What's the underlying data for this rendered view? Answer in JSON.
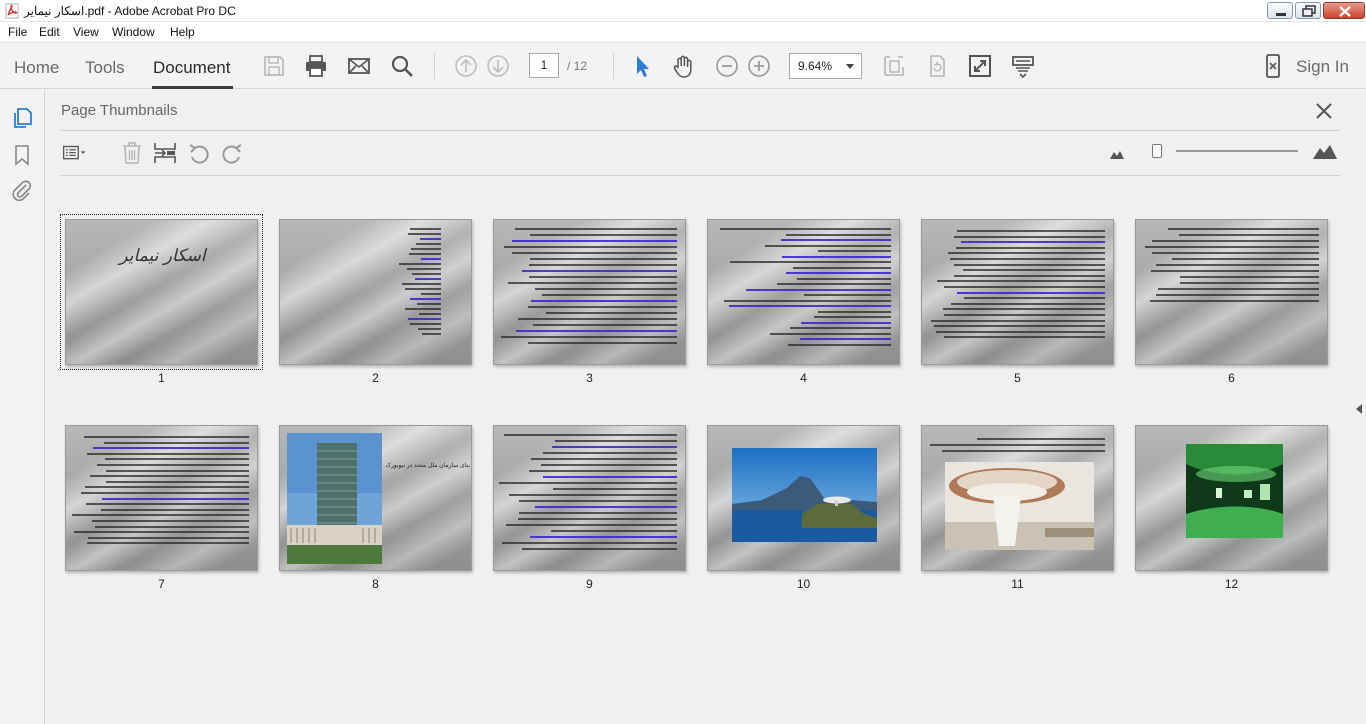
{
  "window": {
    "title": "اسکار نیمایر.pdf - Adobe Acrobat Pro DC"
  },
  "menu": [
    "File",
    "Edit",
    "View",
    "Window",
    "Help"
  ],
  "toolbar": {
    "tabs": [
      "Home",
      "Tools",
      "Document"
    ],
    "active_tab": "Document",
    "page_current": "1",
    "page_total": "/ 12",
    "zoom": "9.64%",
    "sign_in": "Sign In",
    "icons": [
      "save-icon",
      "print-icon",
      "email-icon",
      "search-icon",
      "prev-page-icon",
      "next-page-icon",
      "select-cursor-icon",
      "hand-icon",
      "zoom-out-icon",
      "zoom-in-icon",
      "fit-page-icon",
      "rotate-page-icon",
      "full-screen-icon",
      "scroll-mode-icon",
      "mobile-link-icon"
    ]
  },
  "rail": {
    "icons": [
      "page-thumbnails-icon",
      "bookmarks-icon",
      "attachments-icon"
    ]
  },
  "panel": {
    "title": "Page Thumbnails",
    "tools": [
      "options-menu-icon",
      "delete-page-icon",
      "insert-page-icon",
      "undo-icon",
      "redo-icon"
    ],
    "thumb_size_level": 0.2
  },
  "thumbnails": [
    {
      "label": "1",
      "kind": "title",
      "title": "اسکار نیمایر"
    },
    {
      "label": "2",
      "kind": "text"
    },
    {
      "label": "3",
      "kind": "text"
    },
    {
      "label": "4",
      "kind": "text"
    },
    {
      "label": "5",
      "kind": "text"
    },
    {
      "label": "6",
      "kind": "text"
    },
    {
      "label": "7",
      "kind": "text"
    },
    {
      "label": "8",
      "kind": "photo-building",
      "caption": "بنای سازمان ملل متحد در نیویورک"
    },
    {
      "label": "9",
      "kind": "text"
    },
    {
      "label": "10",
      "kind": "photo-sea"
    },
    {
      "label": "11",
      "kind": "photo-disc"
    },
    {
      "label": "12",
      "kind": "photo-green"
    }
  ],
  "colors": {
    "accent": "#2d7dd2",
    "panel_bg": "#f0f0f0",
    "link_text": "#3a2ad0"
  }
}
